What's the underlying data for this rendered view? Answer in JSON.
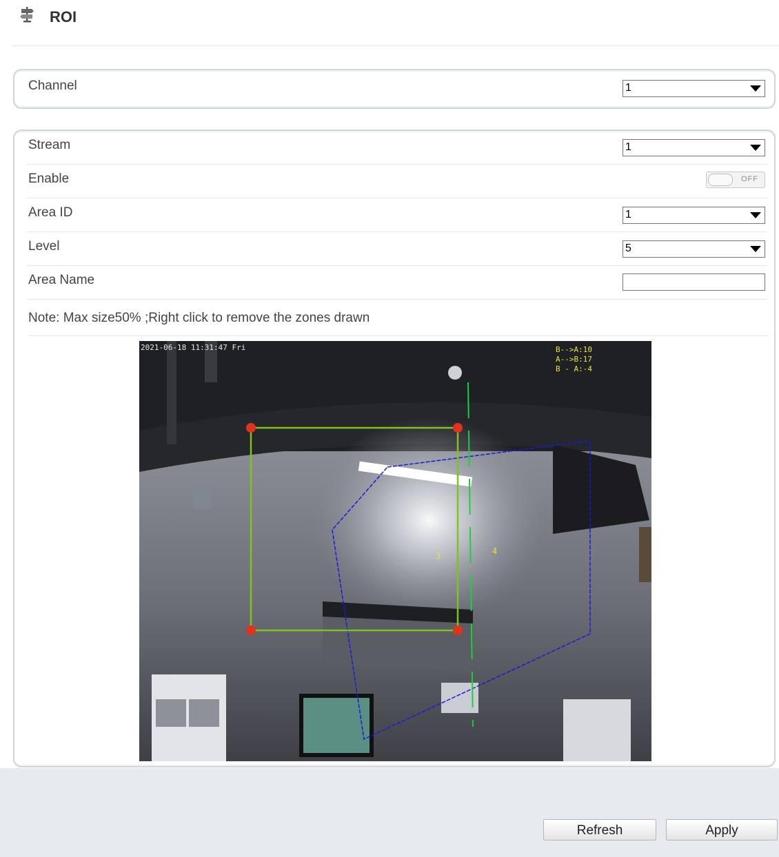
{
  "header": {
    "title": "ROI",
    "icon": "signpost-icon"
  },
  "channel": {
    "label": "Channel",
    "value": "1"
  },
  "form": {
    "stream": {
      "label": "Stream",
      "value": "1"
    },
    "enable": {
      "label": "Enable",
      "state": "OFF"
    },
    "area_id": {
      "label": "Area ID",
      "value": "1"
    },
    "level": {
      "label": "Level",
      "value": "5"
    },
    "area_name": {
      "label": "Area Name",
      "value": ""
    },
    "note": "Note: Max size50% ;Right click to remove the zones drawn"
  },
  "video": {
    "osd_timestamp": "2021-06-18 11:31:47 Fri",
    "osd_stats": [
      "B-->A:10",
      "A-->B:17",
      "B - A:-4"
    ],
    "roi_color": "#7fc31e",
    "handle_color": "#e0321c",
    "line_color_blue": "#1a1ad6",
    "line_color_green": "#1ecf3c",
    "marker_labels": [
      "3",
      "4"
    ]
  },
  "footer": {
    "refresh_label": "Refresh",
    "apply_label": "Apply"
  }
}
